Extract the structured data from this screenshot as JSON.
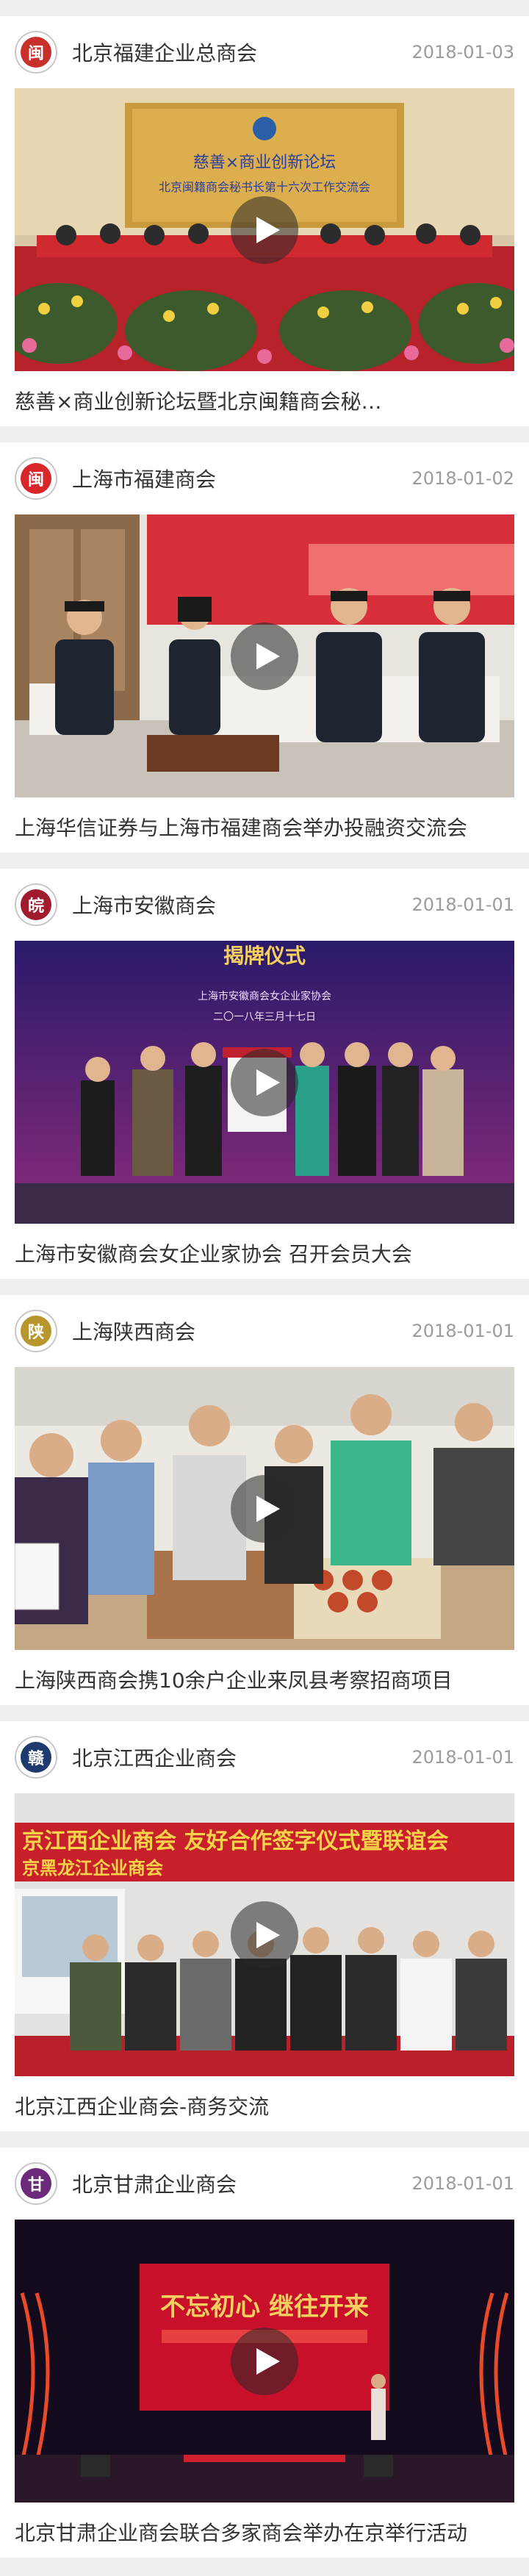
{
  "feed": [
    {
      "org": "北京福建企业总商会",
      "date": "2018-01-03",
      "caption": "慈善×商业创新论坛暨北京闽籍商会秘…",
      "avatar_color": "#c9302c",
      "avatar_glyph": "闽",
      "thumb_icon": "event-photo",
      "banner_line1": "慈善×商业创新论坛",
      "banner_line2": "北京闽籍商会秘书长第十六次工作交流会"
    },
    {
      "org": "上海市福建商会",
      "date": "2018-01-02",
      "caption": "上海华信证券与上海市福建商会举办投融资交流会",
      "avatar_color": "#d9262b",
      "avatar_glyph": "闽",
      "thumb_icon": "event-photo"
    },
    {
      "org": "上海市安徽商会",
      "date": "2018-01-01",
      "caption": "上海市安徽商会女企业家协会 召开会员大会",
      "avatar_color": "#a01b2c",
      "avatar_glyph": "皖",
      "thumb_icon": "event-photo",
      "banner_line1": "揭牌仪式",
      "banner_line2": "上海市安徽商会女企业家协会",
      "banner_line3": "二〇一八年三月十七日"
    },
    {
      "org": "上海陕西商会",
      "date": "2018-01-01",
      "caption": "上海陕西商会携10余户企业来凤县考察招商项目",
      "avatar_color": "#b8962e",
      "avatar_glyph": "陕",
      "thumb_icon": "event-photo"
    },
    {
      "org": "北京江西企业商会",
      "date": "2018-01-01",
      "caption": "北京江西企业商会-商务交流",
      "avatar_color": "#1f3a6e",
      "avatar_glyph": "赣",
      "thumb_icon": "event-photo",
      "banner_line1": "京江西企业商会 友好合作签字仪式暨联谊会",
      "banner_line2": "京黑龙江企业商会"
    },
    {
      "org": "北京甘肃企业商会",
      "date": "2018-01-01",
      "caption": "北京甘肃企业商会联合多家商会举办在京举行活动",
      "avatar_color": "#6b2a7a",
      "avatar_glyph": "甘",
      "thumb_icon": "event-photo",
      "banner_line1": "不忘初心 继往开来"
    }
  ]
}
